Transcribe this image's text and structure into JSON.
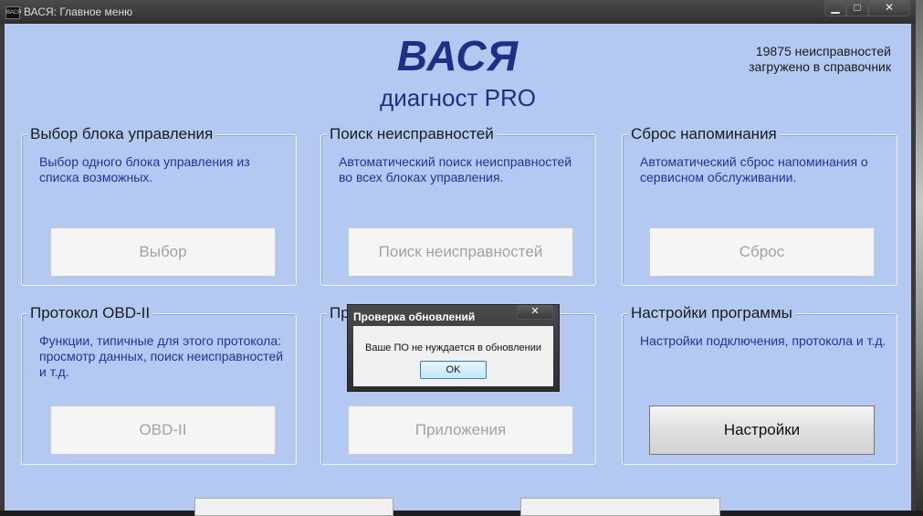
{
  "window": {
    "title": "ВАСЯ:  Главное меню",
    "icon_text": "ВАСЯ",
    "controls": {
      "minimize": "▁",
      "maximize": "□",
      "close": "✕"
    }
  },
  "header": {
    "logo": "ВАСЯ",
    "subtitle": "диагност PRO",
    "faults_line1": "19875 неисправностей",
    "faults_line2": "загружено в справочник"
  },
  "groups": [
    {
      "title": "Выбор блока управления",
      "description": "Выбор одного блока управления из списка возможных.",
      "button": "Выбор",
      "enabled": false
    },
    {
      "title": "Поиск неисправностей",
      "description": "Автоматический поиск неисправностей во всех блоках управления.",
      "button": "Поиск неисправностей",
      "enabled": false
    },
    {
      "title": "Сброс напоминания",
      "description": "Автоматический сброс напоминания о сервисном обслуживании.",
      "button": "Сброс",
      "enabled": false
    },
    {
      "title": "Протокол OBD-II",
      "description": "Функции, типичные для этого протокола: просмотр данных, поиск неисправностей и т.д.",
      "button": "OBD-II",
      "enabled": false
    },
    {
      "title": "Приложения",
      "description": "",
      "button": "Приложения",
      "enabled": false
    },
    {
      "title": "Настройки программы",
      "description": "Настройки подключения, протокола и т.д.",
      "button": "Настройки",
      "enabled": true
    }
  ],
  "dialog": {
    "title": "Проверка обновлений",
    "close": "✕",
    "message": "Ваше ПО не нуждается в обновлении",
    "ok": "OK"
  }
}
